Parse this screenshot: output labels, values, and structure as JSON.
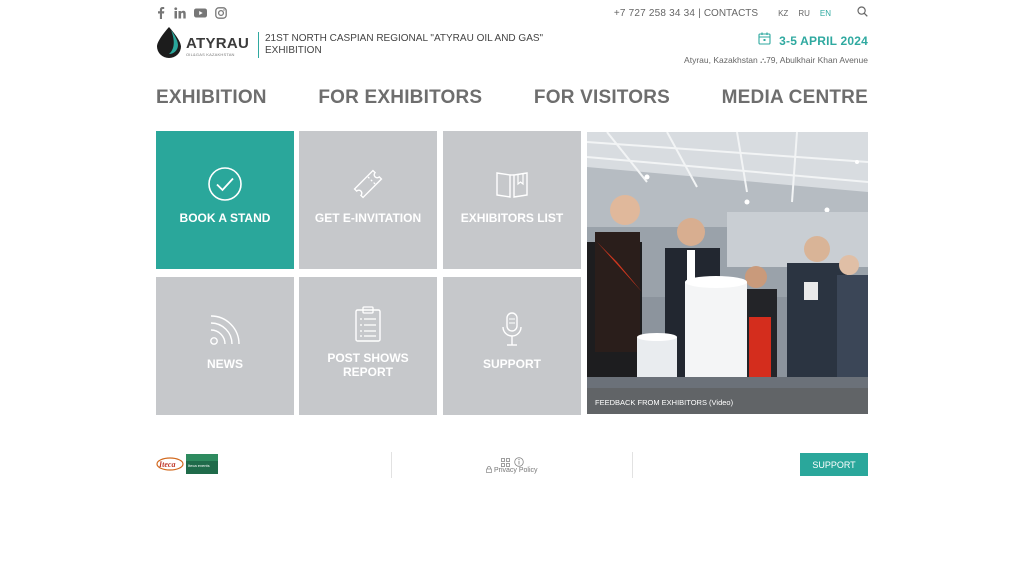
{
  "topbar": {
    "phone": "+7 727 258 34 34",
    "separator": "|",
    "contacts_label": "CONTACTS",
    "languages": [
      "KZ",
      "RU",
      "EN"
    ],
    "active_language": "EN"
  },
  "header": {
    "logo_text": "ATYRAU",
    "logo_subtext": "OIL&GAS KAZAKHSTAN",
    "title": "21ST NORTH CASPIAN REGIONAL \"ATYRAU OIL AND GAS\" EXHIBITION",
    "date": "3-5 APRIL 2024",
    "location": "Atyrau, Kazakhstan ⛬79, Abulkhair Khan Avenue"
  },
  "nav": {
    "items": [
      "EXHIBITION",
      "FOR EXHIBITORS",
      "FOR VISITORS",
      "MEDIA CENTRE"
    ]
  },
  "tiles": [
    {
      "label": "BOOK A STAND",
      "icon": "checkmark-circle-icon"
    },
    {
      "label": "GET E-INVITATION",
      "icon": "ticket-icon"
    },
    {
      "label": "EXHIBITORS LIST",
      "icon": "book-icon"
    },
    {
      "label": "NEWS",
      "icon": "rss-icon"
    },
    {
      "label": "POST SHOWS REPORT",
      "icon": "clipboard-icon"
    },
    {
      "label": "SUPPORT",
      "icon": "microphone-icon"
    }
  ],
  "video": {
    "caption": "FEEDBACK FROM EXHIBITORS (Video)"
  },
  "footer": {
    "partner_1": "Iteca",
    "partner_2": "Iteca events",
    "privacy_label": "Privacy Policy",
    "support_label": "SUPPORT"
  },
  "colors": {
    "accent": "#2aa79b",
    "tile_gray": "#c6c8cb",
    "nav_text": "#6e6e6e"
  }
}
